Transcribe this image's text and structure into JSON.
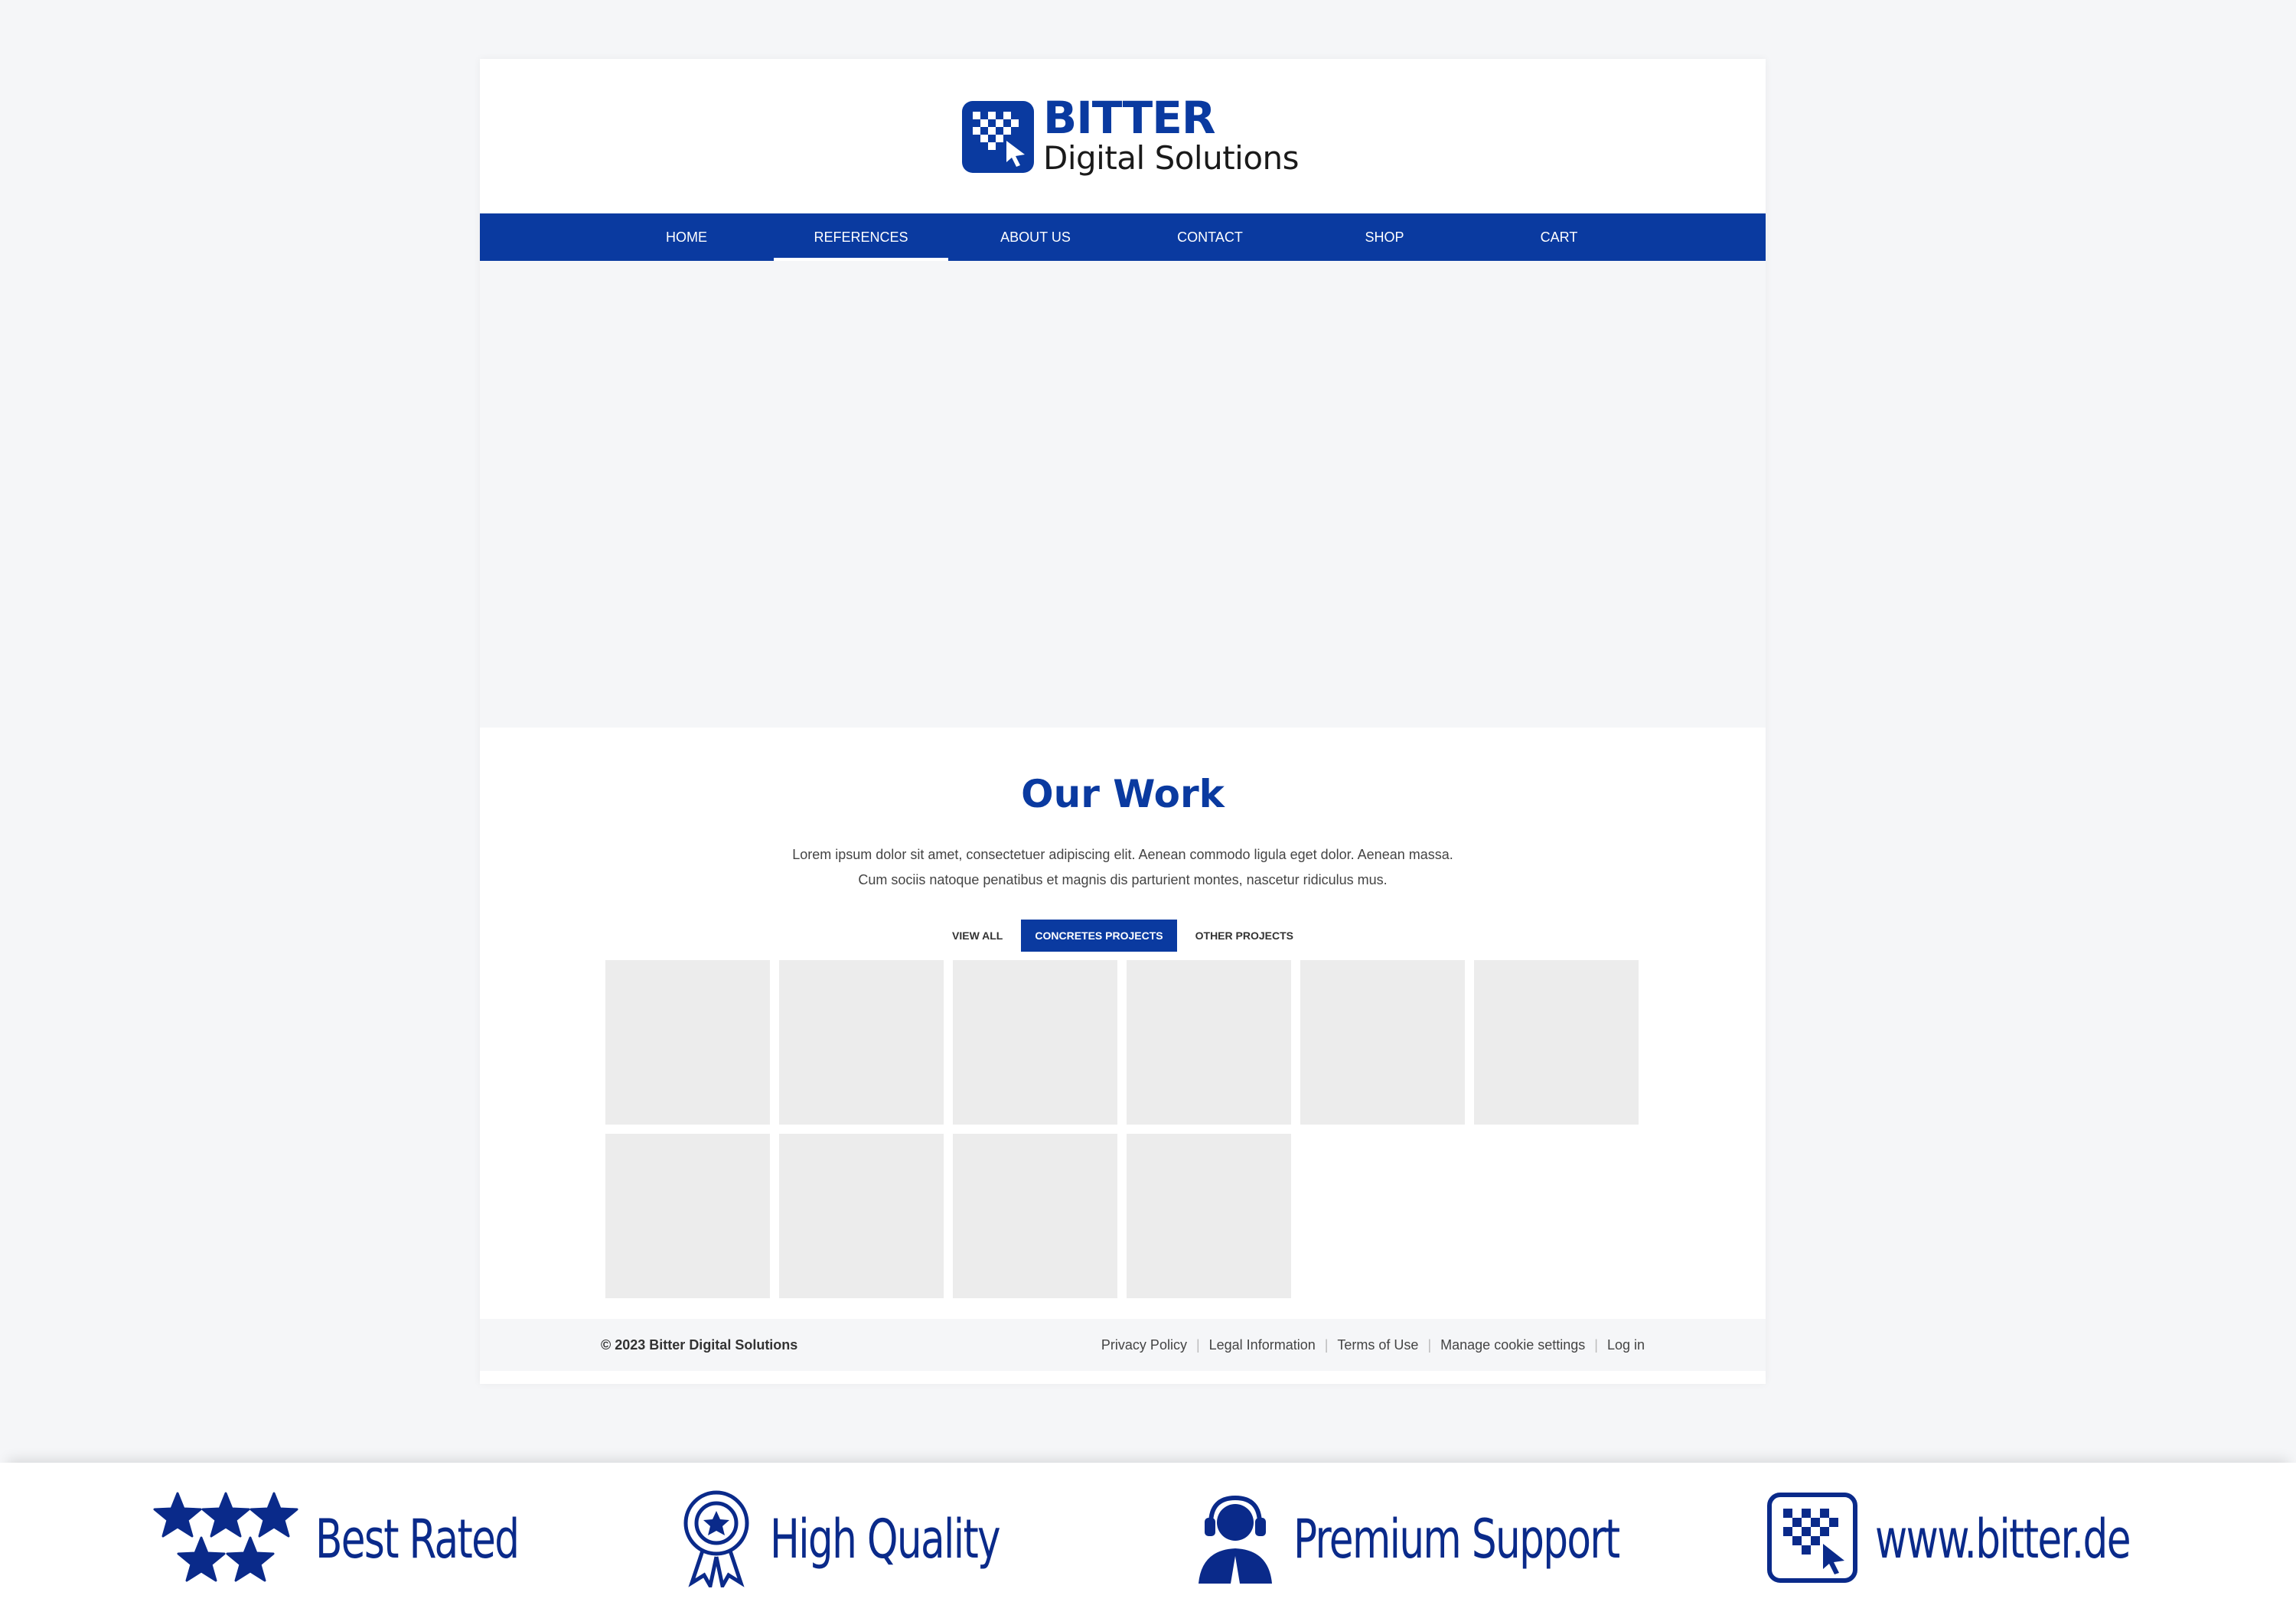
{
  "brand": {
    "name": "BITTER",
    "tagline": "Digital Solutions",
    "color": "#0a3aa0"
  },
  "nav": {
    "items": [
      {
        "label": "HOME",
        "active": false
      },
      {
        "label": "REFERENCES",
        "active": true
      },
      {
        "label": "ABOUT US",
        "active": false
      },
      {
        "label": "CONTACT",
        "active": false
      },
      {
        "label": "SHOP",
        "active": false
      },
      {
        "label": "CART",
        "active": false
      }
    ]
  },
  "work": {
    "title": "Our Work",
    "description": "Lorem ipsum dolor sit amet, consectetuer adipiscing elit. Aenean commodo ligula eget dolor. Aenean massa. Cum sociis natoque penatibus et magnis dis parturient montes, nascetur ridiculus mus.",
    "filters": [
      {
        "label": "VIEW ALL",
        "active": false
      },
      {
        "label": "CONCRETES PROJECTS",
        "active": true
      },
      {
        "label": "OTHER PROJECTS",
        "active": false
      }
    ],
    "tile_count": 10
  },
  "footer": {
    "copyright": "© 2023 Bitter Digital Solutions",
    "links": [
      "Privacy Policy",
      "Legal Information",
      "Terms of Use",
      "Manage cookie settings",
      "Log in"
    ]
  },
  "banner": {
    "items": [
      {
        "icon": "stars-icon",
        "label": "Best Rated"
      },
      {
        "icon": "award-ribbon-icon",
        "label": "High Quality"
      },
      {
        "icon": "headset-support-icon",
        "label": "Premium Support"
      },
      {
        "icon": "bitter-logo-icon",
        "label": "www.bitter.de"
      }
    ],
    "color": "#0a2a8a"
  }
}
